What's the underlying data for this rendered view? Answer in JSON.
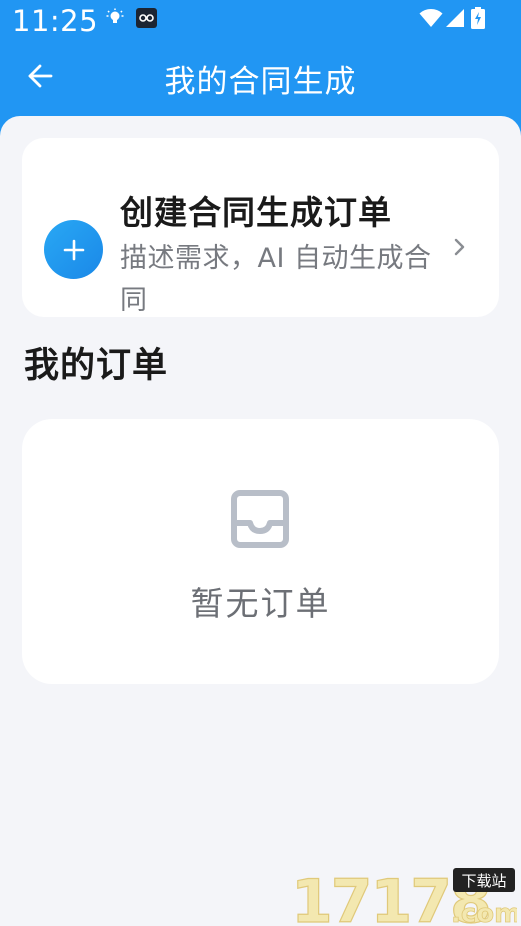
{
  "status_bar": {
    "time": "11:25"
  },
  "header": {
    "title": "我的合同生成"
  },
  "create_card": {
    "title": "创建合同生成订单",
    "description": "描述需求，AI 自动生成合同"
  },
  "orders": {
    "section_title": "我的订单",
    "empty_text": "暂无订单"
  },
  "watermark": {
    "number": "17178",
    "badge": "下载站",
    "suffix": ".com"
  },
  "colors": {
    "header_bg": "#2196f3",
    "page_bg": "#f4f5f9",
    "accent": "#1a88e8",
    "empty_icon": "#b8bec8"
  },
  "icons": {
    "back": "arrow-left-icon",
    "add": "plus-icon",
    "chevron": "chevron-right-icon",
    "empty": "inbox-tray-icon",
    "wifi": "wifi-icon",
    "signal": "cell-signal-icon",
    "battery": "battery-charging-icon",
    "notification": "lightbulb-icon"
  }
}
